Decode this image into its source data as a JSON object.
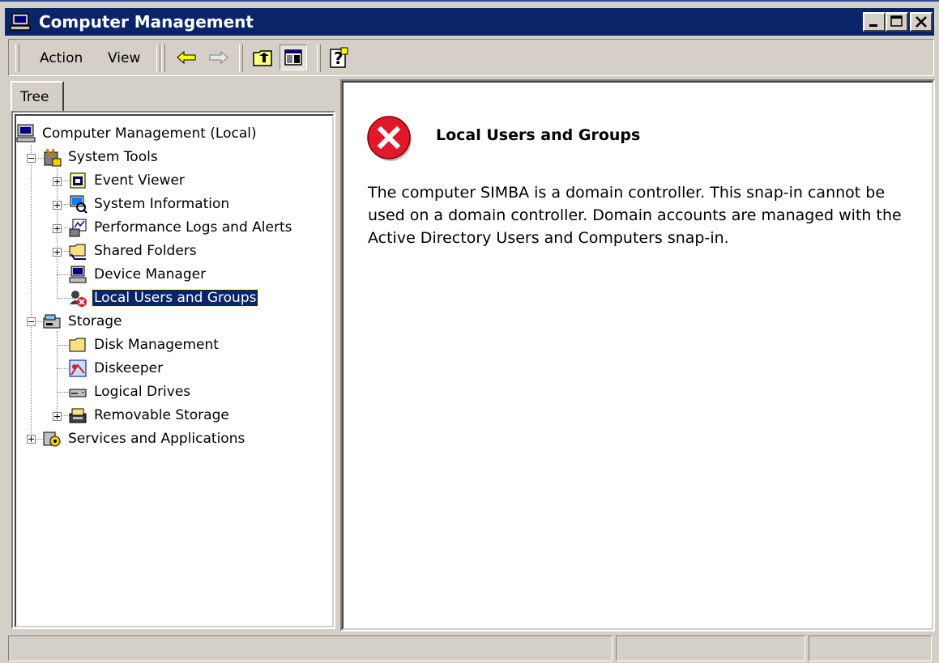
{
  "window": {
    "title": "Computer Management"
  },
  "menu": {
    "action": "Action",
    "view": "View"
  },
  "toolbar": {
    "icons": [
      "back-icon",
      "forward-icon",
      "up-one-level-icon",
      "show-hide-tree-icon",
      "help-icon"
    ]
  },
  "tabs": [
    {
      "label": "Tree"
    }
  ],
  "tree": {
    "root": "Computer Management (Local)",
    "system_tools": "System Tools",
    "event_viewer": "Event Viewer",
    "system_information": "System Information",
    "perf_logs": "Performance Logs and Alerts",
    "shared_folders": "Shared Folders",
    "device_manager": "Device Manager",
    "local_users": "Local Users and Groups",
    "storage": "Storage",
    "disk_management": "Disk Management",
    "diskeeper": "Diskeeper",
    "logical_drives": "Logical Drives",
    "removable_storage": "Removable Storage",
    "services_apps": "Services and Applications",
    "selected": "Local Users and Groups"
  },
  "content": {
    "title": "Local Users and Groups",
    "message": "The computer SIMBA is a domain controller.  This snap-in cannot be used on a domain controller.  Domain accounts are managed with the Active Directory Users and Computers snap-in."
  },
  "colors": {
    "titlebar": "#0a246a",
    "face": "#d4d0c8",
    "selection": "#0a246a",
    "error": "#e0182a"
  }
}
